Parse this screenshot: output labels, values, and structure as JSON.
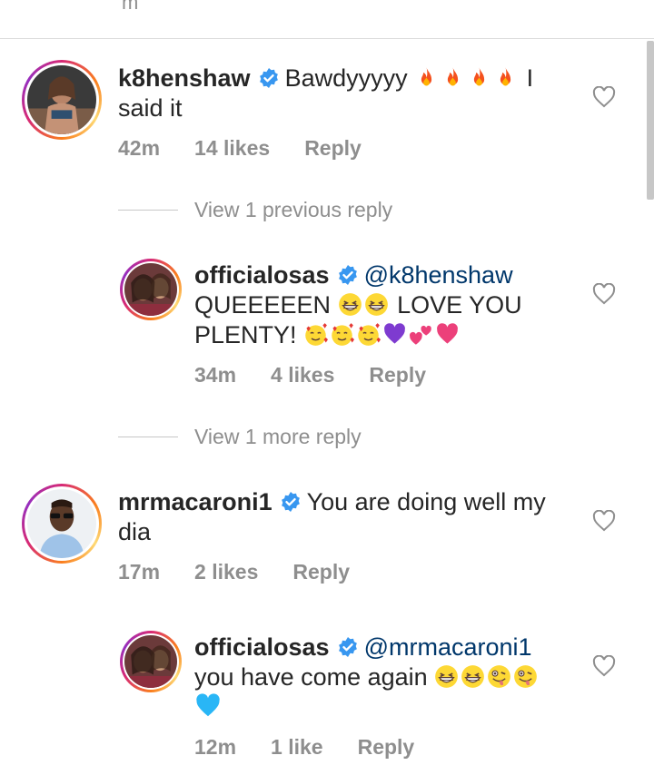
{
  "top_partial": "m",
  "comments": [
    {
      "username": "k8henshaw",
      "text_line1": "Bawdyyyyy",
      "text_line1_tail": "I",
      "text_line2": "said it",
      "emojis": [
        "fire",
        "fire",
        "fire",
        "fire"
      ],
      "time": "42m",
      "likes": "14 likes",
      "reply": "Reply"
    },
    {
      "username": "officialosas",
      "mention": "@k8henshaw",
      "text_line1": "QUEEEEEN",
      "text_line1_tail": "LOVE YOU",
      "text_line2": "PLENTY!",
      "time": "34m",
      "likes": "4 likes",
      "reply": "Reply"
    },
    {
      "username": "mrmacaroni1",
      "text_line1": "You are doing well my",
      "text_line2": "dia",
      "time": "17m",
      "likes": "2 likes",
      "reply": "Reply"
    },
    {
      "username": "officialosas",
      "mention": "@mrmacaroni1",
      "text_line1": "you have come again",
      "time": "12m",
      "likes": "1 like",
      "reply": "Reply"
    }
  ],
  "view_replies": [
    {
      "label": "View 1 previous reply"
    },
    {
      "label": "View 1 more reply"
    }
  ],
  "colors": {
    "verified": "#3897f0",
    "mention": "#00376b",
    "meta": "#8e8e8e"
  }
}
